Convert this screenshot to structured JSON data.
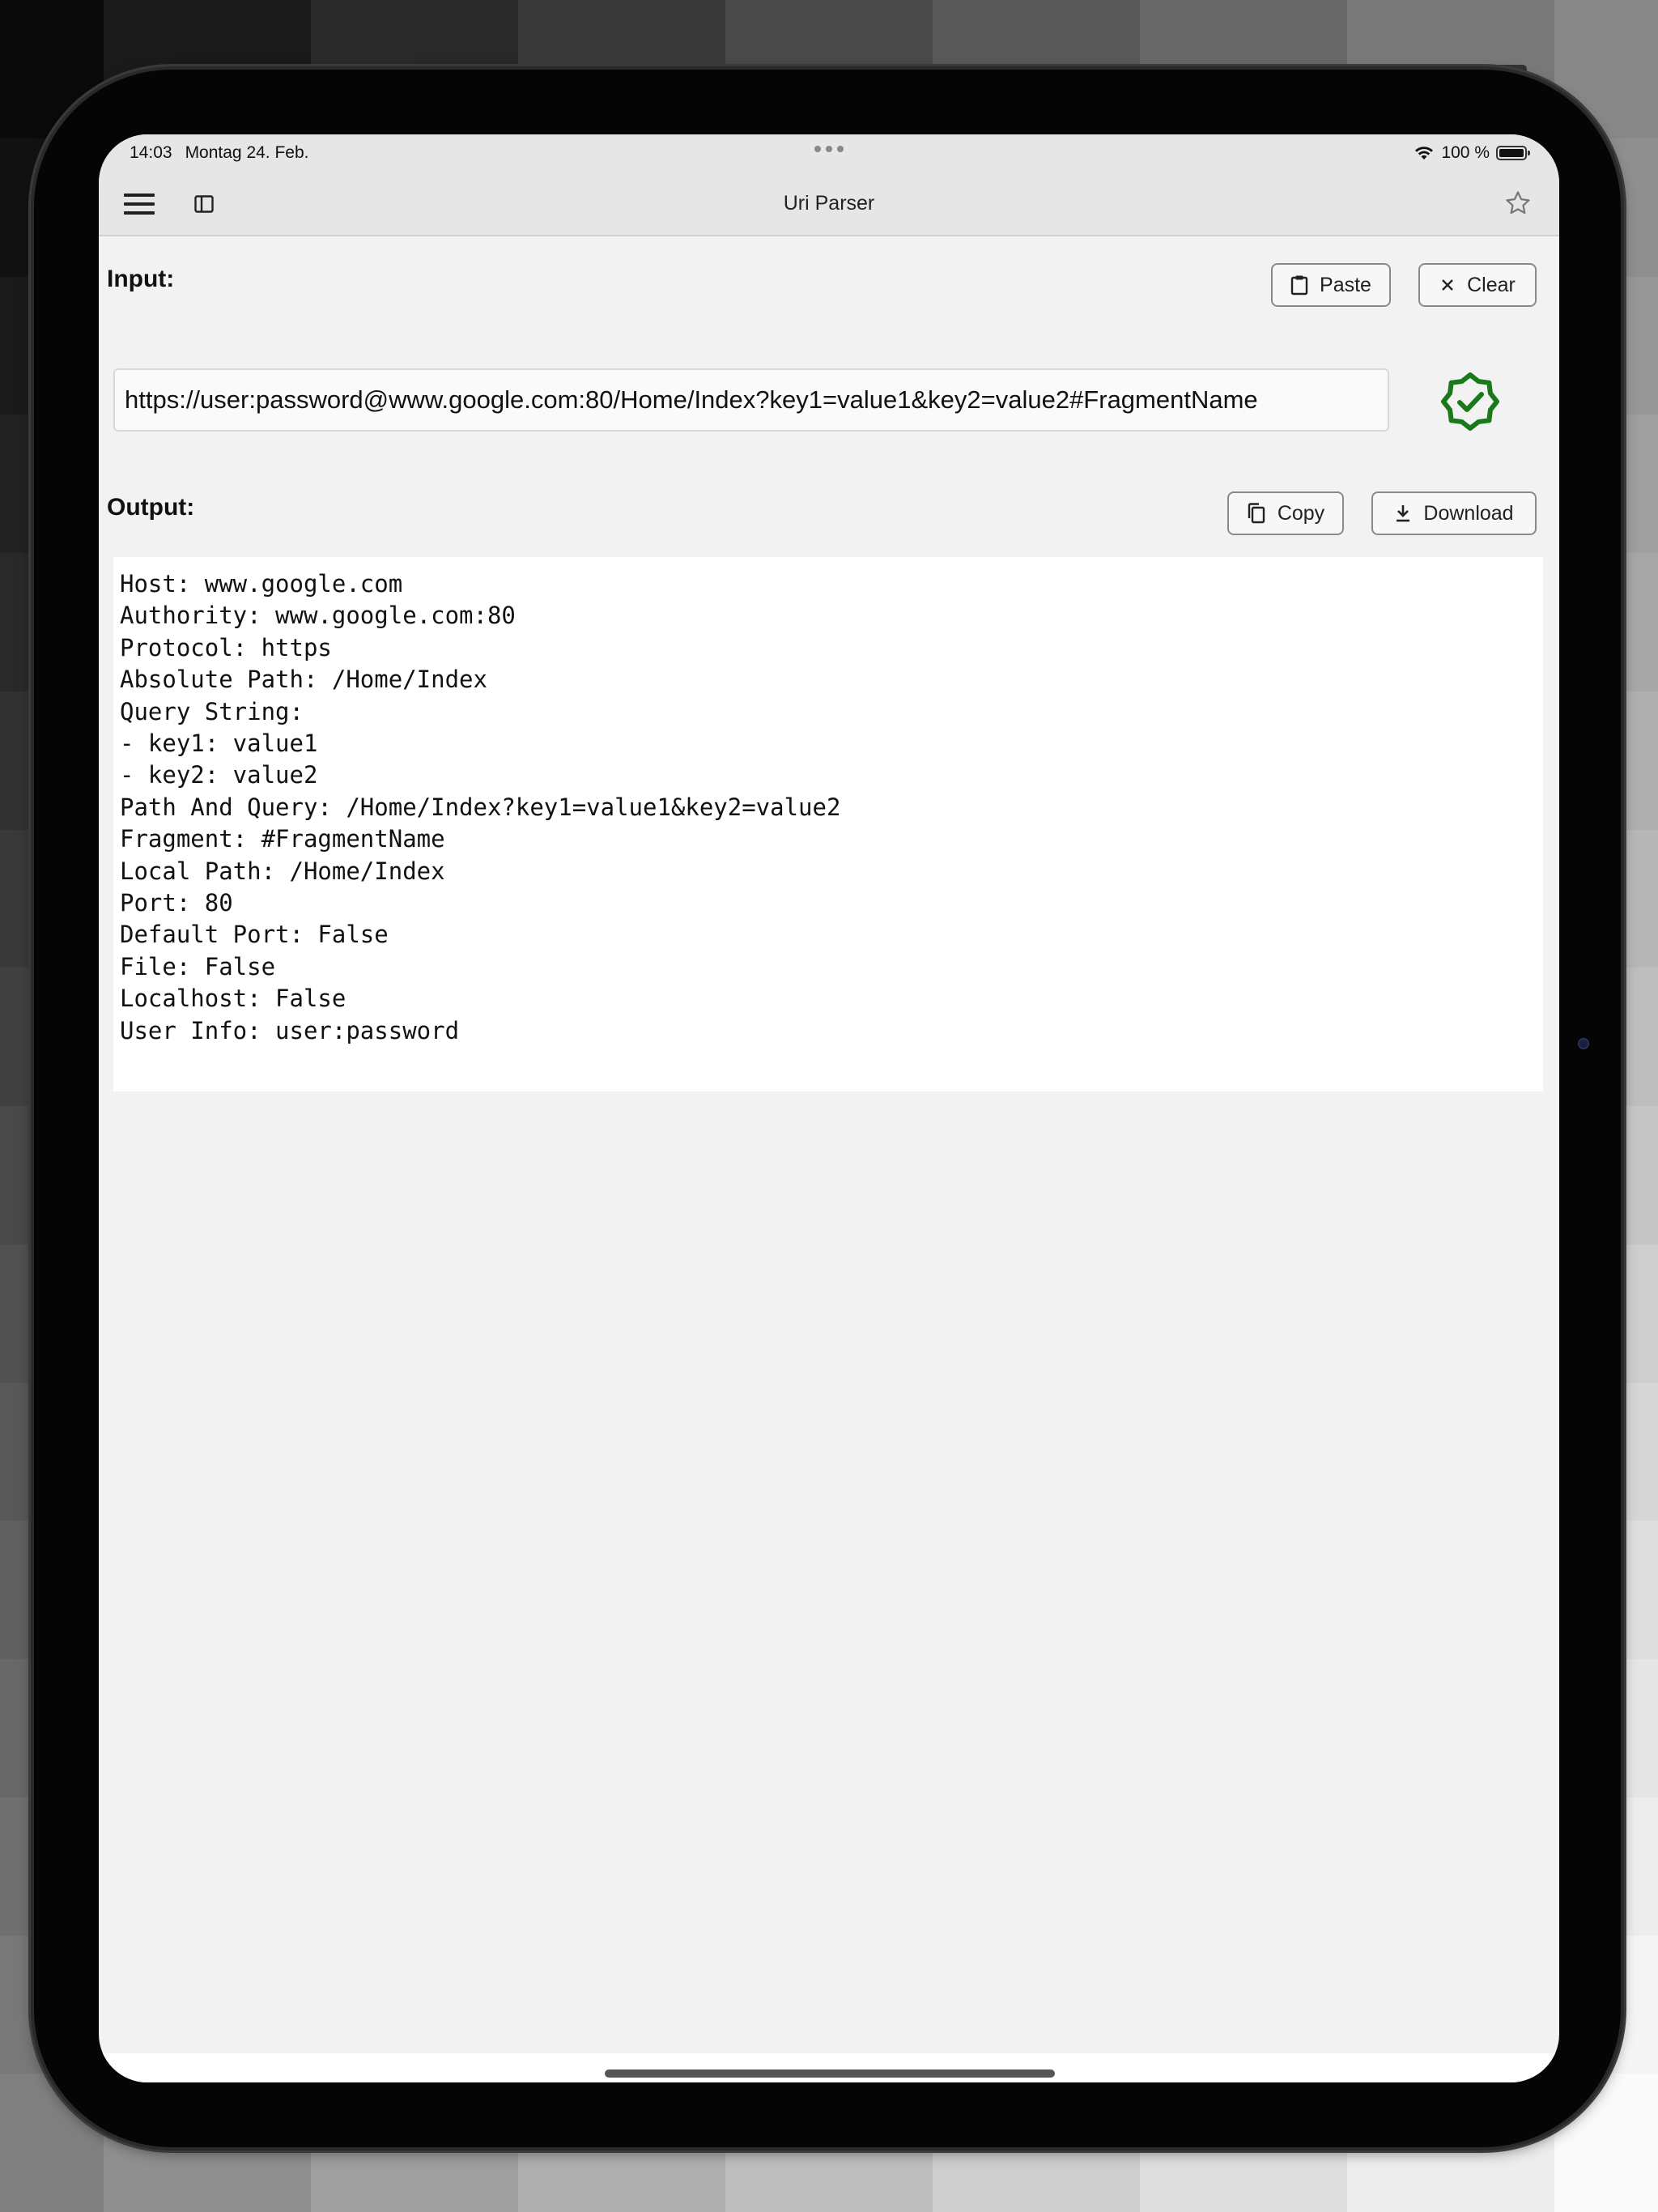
{
  "status_bar": {
    "time": "14:03",
    "date": "Montag 24. Feb.",
    "battery_text": "100 %",
    "battery_level": 1.0
  },
  "nav": {
    "title": "Uri Parser",
    "icons": [
      "hamburger-menu-icon",
      "sidebar-toggle-icon",
      "favorite-star-icon"
    ]
  },
  "input_section": {
    "label": "Input:",
    "paste_label": "Paste",
    "clear_label": "Clear",
    "value": "https://user:password@www.google.com:80/Home/Index?key1=value1&key2=value2#FragmentName",
    "valid": true,
    "valid_color": "#1a7a1a"
  },
  "output_section": {
    "label": "Output:",
    "copy_label": "Copy",
    "download_label": "Download",
    "lines": [
      "Host: www.google.com",
      "Authority: www.google.com:80",
      "Protocol: https",
      "Absolute Path: /Home/Index",
      "Query String:",
      "- key1: value1",
      "- key2: value2",
      "Path And Query: /Home/Index?key1=value1&key2=value2",
      "Fragment: #FragmentName",
      "Local Path: /Home/Index",
      "Port: 80",
      "Default Port: False",
      "File: False",
      "Localhost: False",
      "User Info: user:password"
    ]
  }
}
